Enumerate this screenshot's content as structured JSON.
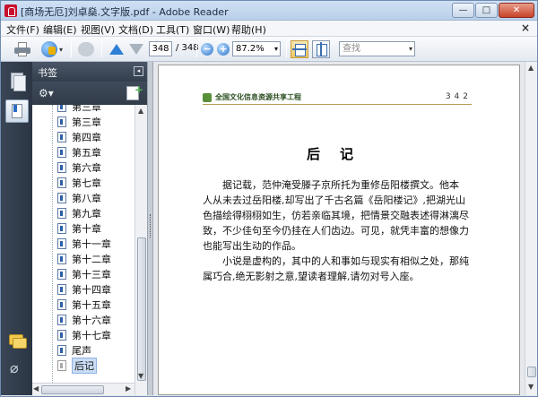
{
  "window": {
    "title": "[商场无厄]刘卓燊.文字版.pdf - Adobe Reader",
    "minimize_glyph": "—",
    "maximize_glyph": "□",
    "close_glyph": "✕"
  },
  "menu": {
    "items": [
      {
        "label": "文件(F)"
      },
      {
        "label": "编辑(E)"
      },
      {
        "label": "视图(V)"
      },
      {
        "label": "文档(D)"
      },
      {
        "label": "工具(T)"
      },
      {
        "label": "窗口(W)"
      },
      {
        "label": "帮助(H)"
      }
    ],
    "close_glyph": "×"
  },
  "toolbar": {
    "current_page": "348",
    "total_pages": "/ 348",
    "zoom_out_glyph": "−",
    "zoom_in_glyph": "+",
    "zoom_level": "87.2%",
    "search_placeholder": "查找",
    "caret_glyph": "▾",
    "icons": [
      "printer-icon",
      "collaborate-icon",
      "secure-hands-icon",
      "previous-page-icon",
      "next-page-icon",
      "zoom-out-icon",
      "zoom-in-icon",
      "fit-page-icon",
      "fit-width-icon"
    ]
  },
  "nav": {
    "icons": [
      "pages-icon",
      "bookmarks-icon",
      "comments-icon",
      "attachments-icon"
    ],
    "attach_glyph": "⌀"
  },
  "bookmarks": {
    "title": "书签",
    "collapse_glyph": "◂",
    "options_glyph": "⚙▾",
    "items": [
      {
        "label": "第三章",
        "selected": false
      },
      {
        "label": "第三章",
        "selected": false
      },
      {
        "label": "第四章",
        "selected": false
      },
      {
        "label": "第五章",
        "selected": false
      },
      {
        "label": "第六章",
        "selected": false
      },
      {
        "label": "第七章",
        "selected": false
      },
      {
        "label": "第八章",
        "selected": false
      },
      {
        "label": "第九章",
        "selected": false
      },
      {
        "label": "第十章",
        "selected": false
      },
      {
        "label": "第十一章",
        "selected": false
      },
      {
        "label": "第十二章",
        "selected": false
      },
      {
        "label": "第十三章",
        "selected": false
      },
      {
        "label": "第十四章",
        "selected": false
      },
      {
        "label": "第十五章",
        "selected": false
      },
      {
        "label": "第十六章",
        "selected": false
      },
      {
        "label": "第十七章",
        "selected": false
      },
      {
        "label": "尾声",
        "selected": false
      },
      {
        "label": "后记",
        "selected": true
      }
    ],
    "scroll_up_glyph": "▲",
    "scroll_down_glyph": "▼",
    "scroll_left_glyph": "◀",
    "scroll_right_glyph": "▶"
  },
  "document": {
    "header_title": "全国文化信息资源共享工程",
    "header_page_number": "342",
    "chapter_title": "后记",
    "paragraph1": [
      "据记载，范仲淹受滕子京所托为重修岳阳楼撰文。他本",
      "人从未去过岳阳楼,却写出了千古名篇《岳阳楼记》,把湖光山",
      "色描绘得栩栩如生，仿若亲临其境，把情景交融表述得淋漓尽",
      "致，不少佳句至今仍挂在人们齿边。可见，就凭丰富的想像力",
      "也能写出生动的作品。"
    ],
    "paragraph2": [
      "小说是虚构的，其中的人和事如与现实有相似之处，那纯",
      "属巧合,绝无影射之意,望读者理解,请勿对号入座。"
    ]
  },
  "colors": {
    "accent": "#2b6bc2",
    "header_rule": "#b59b56",
    "logo_green": "#5a8f3a"
  }
}
